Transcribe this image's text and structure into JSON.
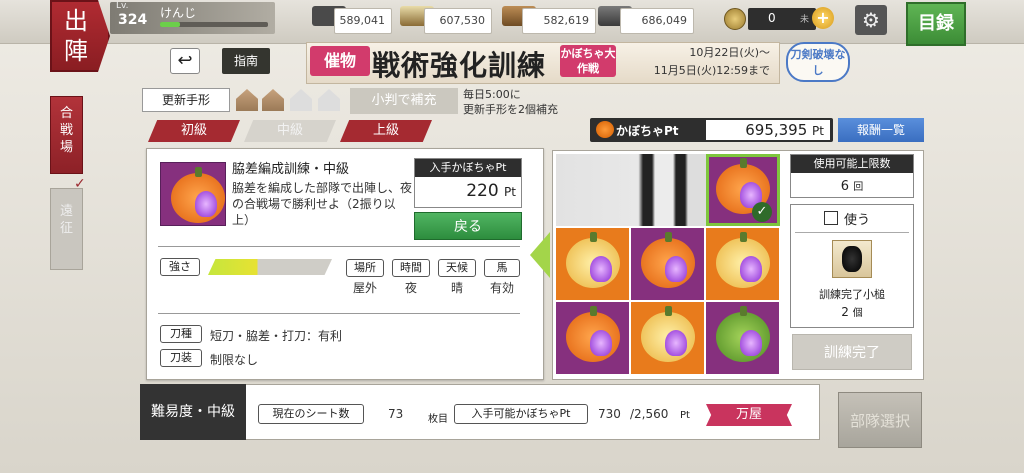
{
  "player": {
    "level_label": "Lv.",
    "level": "324",
    "name": "けんじ"
  },
  "resources": [
    "589,041",
    "607,530",
    "582,619",
    "686,049"
  ],
  "coins": {
    "value": "0",
    "unit": "未"
  },
  "nav": {
    "catalog": "目録",
    "deploy": "出陣",
    "battlefield": "合戦場",
    "expedition": "遠征"
  },
  "header": {
    "guide": "指南",
    "event_tag": "催物",
    "event_title": "戦術強化訓練",
    "event_sub": "かぼちゃ大作戦",
    "period_start": "10月22日(火)〜",
    "period_end": "11月5日(火)12:59まで",
    "sword_break": "刀剣破壊なし"
  },
  "refresh": {
    "label": "更新手形",
    "refill": "小判で補充",
    "note1": "毎日5:00に",
    "note2": "更新手形を2個補充"
  },
  "tabs": [
    "初級",
    "中級",
    "上級"
  ],
  "points": {
    "label": "かぼちゃPt",
    "value": "695,395",
    "unit": "Pt",
    "rewards": "報酬一覧"
  },
  "stage": {
    "title": "脇差編成訓練・中級",
    "description": "脇差を編成した部隊で出陣し、夜の合戦場で勝利せよ（2振り以上）",
    "get_label": "入手かぼちゃPt",
    "get_value": "220",
    "get_unit": "Pt",
    "back": "戻る",
    "strength_label": "強さ",
    "strength": 0.4,
    "conditions": [
      {
        "label": "場所",
        "value": "屋外"
      },
      {
        "label": "時間",
        "value": "夜"
      },
      {
        "label": "天候",
        "value": "晴"
      },
      {
        "label": "馬",
        "value": "有効"
      }
    ],
    "sword_type_label": "刀種",
    "sword_type_value": "短刀・脇差・打刀：有利",
    "equip_label": "刀装",
    "equip_value": "制限なし"
  },
  "side": {
    "limit_label": "使用可能上限数",
    "limit_value": "6",
    "limit_unit": "回",
    "use_label": "使う",
    "item_name": "訓練完了小槌",
    "item_count": "2",
    "item_unit": "個",
    "complete": "訓練完了"
  },
  "bottom": {
    "difficulty": "難易度・中級",
    "sheet_label": "現在のシート数",
    "sheet_value": "73",
    "sheet_unit": "枚目",
    "avail_label": "入手可能かぼちゃPt",
    "avail_value": "730",
    "avail_total": "/2,560",
    "avail_unit": "Pt",
    "shop": "万屋",
    "squad": "部隊選択"
  },
  "colors": {
    "accent_red": "#a52a31",
    "accent_green": "#3c9a4b",
    "pumpkin_purple": "#86307e",
    "pumpkin_orange": "#f07e1e"
  }
}
